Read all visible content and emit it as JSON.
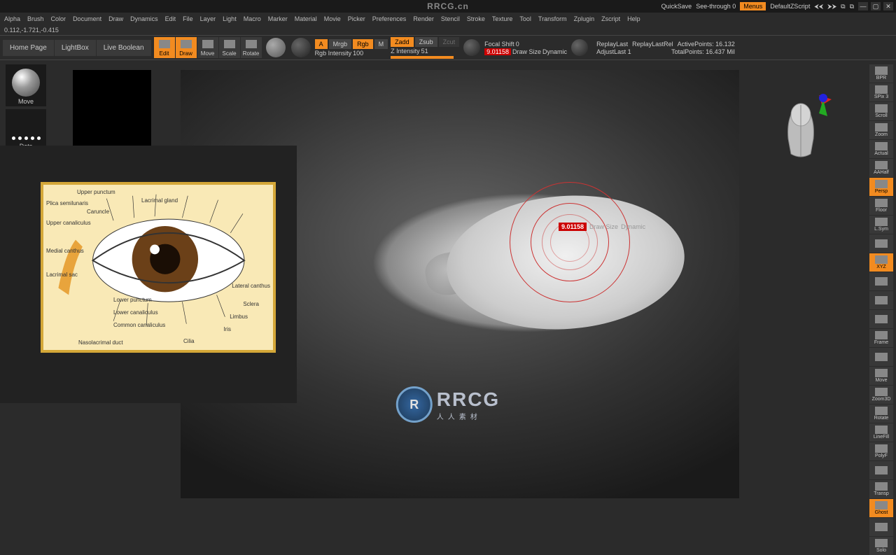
{
  "titlebar": {
    "quicksave": "QuickSave",
    "seethrough": "See-through",
    "seethrough_val": "0",
    "menus": "Menus",
    "default_zscript": "DefaultZScript"
  },
  "menu": [
    "Alpha",
    "Brush",
    "Color",
    "Document",
    "Draw",
    "Dynamics",
    "Edit",
    "File",
    "Layer",
    "Light",
    "Macro",
    "Marker",
    "Material",
    "Movie",
    "Picker",
    "Preferences",
    "Render",
    "Stencil",
    "Stroke",
    "Texture",
    "Tool",
    "Transform",
    "Zplugin",
    "Zscript",
    "Help"
  ],
  "coords": "0.112,-1.721,-0.415",
  "toolbar": {
    "tabs": {
      "home": "Home Page",
      "lightbox": "LightBox",
      "livebool": "Live Boolean"
    },
    "modes": {
      "edit": "Edit",
      "draw": "Draw",
      "move": "Move",
      "scale": "Scale",
      "rotate": "Rotate"
    },
    "mrgb_a": "A",
    "mrgb": "Mrgb",
    "rgb": "Rgb",
    "m": "M",
    "rgb_int": "Rgb Intensity",
    "rgb_int_val": "100",
    "zadd": "Zadd",
    "zsub": "Zsub",
    "zcut": "Zcut",
    "z_int": "Z Intensity",
    "z_int_val": "51",
    "focal": "Focal Shift",
    "focal_val": "0",
    "drawsize_val": "9.01158",
    "drawsize": "Draw Size",
    "dynamic": "Dynamic",
    "replay": "ReplayLast",
    "replayrel": "ReplayLastRel",
    "adjust": "AdjustLast",
    "adjust_val": "1",
    "active": "ActivePoints:",
    "active_val": "16.132",
    "total": "TotalPoints:",
    "total_val": "16.437 Mil"
  },
  "left": {
    "move": "Move",
    "dots": "Dots"
  },
  "brush_cursor": {
    "val": "9.01158",
    "label": "Draw Size",
    "dyn": "Dynamic"
  },
  "ref": {
    "labels": {
      "upper_punctum": "Upper punctum",
      "plica": "Plica semilunaris",
      "upper_canal": "Upper canaliculus",
      "caruncle": "Caruncle",
      "medial": "Medial canthus",
      "lacrimal_sac": "Lacrimal sac",
      "lacrimal_gland": "Lacrimal gland",
      "lateral": "Lateral canthus",
      "sclera": "Sclera",
      "limbus": "Limbus",
      "iris": "Iris",
      "cilia": "Cilia",
      "lower_punctum": "Lower punctum",
      "lower_canal": "Lower canaliculus",
      "common_canal": "Common canaliculus",
      "nasolacrimal": "Nasolacrimal duct"
    }
  },
  "rail": [
    "BPR",
    "SPix 3",
    "Scroll",
    "Zoom",
    "Actual",
    "AAHalf",
    "Persp",
    "Floor",
    "L.Sym",
    "",
    "XYZ",
    "",
    "",
    "",
    "Frame",
    "",
    "Move",
    "Zoom3D",
    "Rotate",
    "LineFill",
    "PolyF",
    "",
    "Transp",
    "Ghost",
    "",
    "Solo"
  ],
  "rail_on": [
    false,
    false,
    false,
    false,
    false,
    false,
    true,
    false,
    false,
    false,
    true,
    false,
    false,
    false,
    false,
    false,
    false,
    false,
    false,
    false,
    false,
    false,
    false,
    true,
    false,
    false
  ],
  "watermark": {
    "top": "RRCG.cn",
    "main": "RRCG",
    "sub": "人人素材"
  }
}
